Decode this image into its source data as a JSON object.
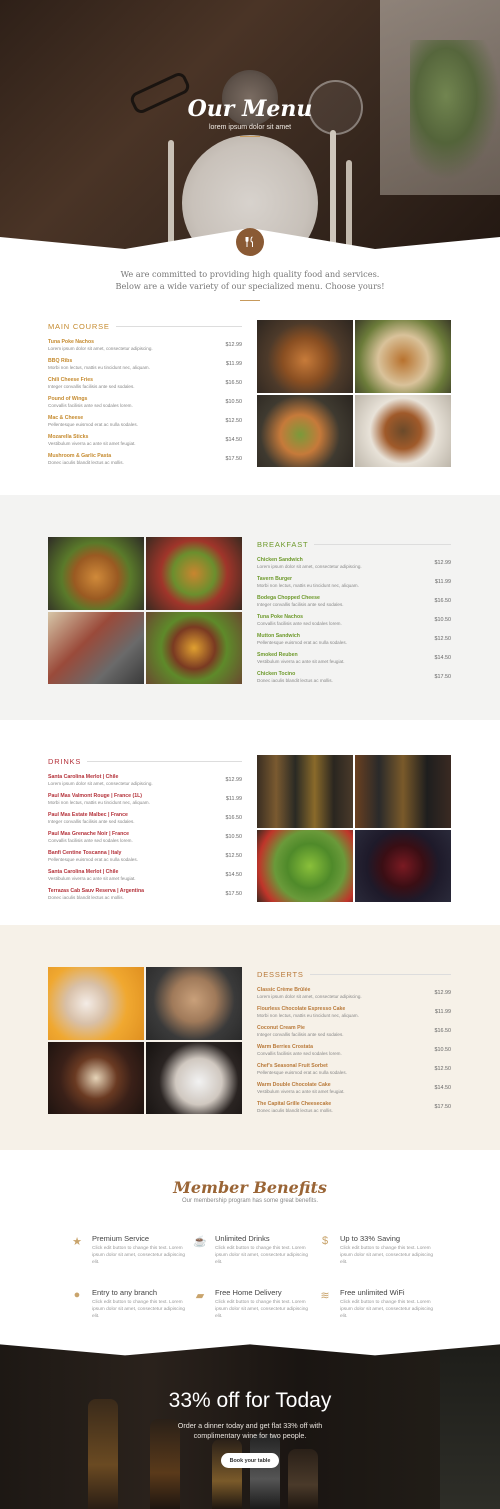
{
  "hero": {
    "title": "Our Menu",
    "subtitle": "lorem ipsum dolor sit amet"
  },
  "intro": "We are committed to providing high quality food and services. Below are a wide variety of our specialized menu. Choose yours!",
  "main_course": {
    "title": "MAIN COURSE",
    "items": [
      {
        "name": "Tuna Poke Nachos",
        "desc": "Lorem ipsum dolor sit amet, consectetur adipiscing.",
        "price": "$12.99"
      },
      {
        "name": "BBQ Ribs",
        "desc": "Morbi non lectus, mattis eu tincidunt nec, aliquam.",
        "price": "$11.99"
      },
      {
        "name": "Chili Cheese Fries",
        "desc": "Integer convallis facilisis ante sed sodales.",
        "price": "$16.50"
      },
      {
        "name": "Pound of Wings",
        "desc": "Convallis facilisis ante sed sodales lorem.",
        "price": "$10.50"
      },
      {
        "name": "Mac & Cheese",
        "desc": "Pellentesque euismod erat ac nulla sodales.",
        "price": "$12.50"
      },
      {
        "name": "Mozarella Sticks",
        "desc": "Vestibulum viverra ac ante sit amet feugiat.",
        "price": "$14.50"
      },
      {
        "name": "Mushroom & Garlic Pasta",
        "desc": "Donec iaculis blandit lectus ac mollis.",
        "price": "$17.50"
      }
    ]
  },
  "breakfast": {
    "title": "BREAKFAST",
    "items": [
      {
        "name": "Chicken Sandwich",
        "desc": "Lorem ipsum dolor sit amet, consectetur adipiscing.",
        "price": "$12.99"
      },
      {
        "name": "Tavern Burger",
        "desc": "Morbi non lectus, mattis eu tincidunt nec, aliquam.",
        "price": "$11.99"
      },
      {
        "name": "Bodega Chopped Cheese",
        "desc": "Integer convallis facilisis ante sed sodales.",
        "price": "$16.50"
      },
      {
        "name": "Tuna Poke Nachos",
        "desc": "Convallis facilisis ante sed sodales lorem.",
        "price": "$10.50"
      },
      {
        "name": "Mutton Sandwich",
        "desc": "Pellentesque euismod erat ac nulla sodales.",
        "price": "$12.50"
      },
      {
        "name": "Smoked Reuben",
        "desc": "Vestibulum viverra ac ante sit amet feugiat.",
        "price": "$14.50"
      },
      {
        "name": "Chicken Tocino",
        "desc": "Donec iaculis blandit lectus ac mollis.",
        "price": "$17.50"
      }
    ]
  },
  "drinks": {
    "title": "DRINKS",
    "items": [
      {
        "name": "Santa Carolina Merlot | Chile",
        "desc": "Lorem ipsum dolor sit amet, consectetur adipiscing.",
        "price": "$12.99"
      },
      {
        "name": "Paul Mas Valmont Rouge | France (1L)",
        "desc": "Morbi non lectus, mattis eu tincidunt nec, aliquam.",
        "price": "$11.99"
      },
      {
        "name": "Paul Mas Estate Malbec | France",
        "desc": "Integer convallis facilisis ante sed sodales.",
        "price": "$16.50"
      },
      {
        "name": "Paul Mas Grenache Noir | France",
        "desc": "Convallis facilisis ante sed sodales lorem.",
        "price": "$10.50"
      },
      {
        "name": "Banfi Centine Toscanna | Italy",
        "desc": "Pellentesque euismod erat ac nulla sodales.",
        "price": "$12.50"
      },
      {
        "name": "Santa Carolina Merlot | Chile",
        "desc": "Vestibulum viverra ac ante sit amet feugiat.",
        "price": "$14.50"
      },
      {
        "name": "Terrazas Cab Sauv Reserva | Argentina",
        "desc": "Donec iaculis blandit lectus ac mollis.",
        "price": "$17.50"
      }
    ]
  },
  "desserts": {
    "title": "DESSERTS",
    "items": [
      {
        "name": "Classic Crème Brûlée",
        "desc": "Lorem ipsum dolor sit amet, consectetur adipiscing.",
        "price": "$12.99"
      },
      {
        "name": "Flourless Chocolate Espresso Cake",
        "desc": "Morbi non lectus, mattis eu tincidunt nec, aliquam.",
        "price": "$11.99"
      },
      {
        "name": "Coconut Cream Pie",
        "desc": "Integer convallis facilisis ante sed sodales.",
        "price": "$16.50"
      },
      {
        "name": "Warm Berries Crostata",
        "desc": "Convallis facilisis ante sed sodales lorem.",
        "price": "$10.50"
      },
      {
        "name": "Chef's Seasonal Fruit Sorbet",
        "desc": "Pellentesque euismod erat ac nulla sodales.",
        "price": "$12.50"
      },
      {
        "name": "Warm Double Chocolate Cake",
        "desc": "Vestibulum viverra ac ante sit amet feugiat.",
        "price": "$14.50"
      },
      {
        "name": "The Capital Grille Cheesecake",
        "desc": "Donec iaculis blandit lectus ac mollis.",
        "price": "$17.50"
      }
    ]
  },
  "member": {
    "title": "Member Benefits",
    "subtitle": "Our membership program has some great benefits.",
    "benefits": [
      {
        "title": "Premium Service",
        "desc": "Click edit button to change this text. Lorem ipsum dolor sit amet, consectetur adipiscing elit.",
        "icon": "star-icon"
      },
      {
        "title": "Unlimited Drinks",
        "desc": "Click edit button to change this text. Lorem ipsum dolor sit amet, consectetur adipiscing elit.",
        "icon": "cup-icon"
      },
      {
        "title": "Up to 33% Saving",
        "desc": "Click edit button to change this text. Lorem ipsum dolor sit amet, consectetur adipiscing elit.",
        "icon": "money-icon"
      },
      {
        "title": "Entry to any branch",
        "desc": "Click edit button to change this text. Lorem ipsum dolor sit amet, consectetur adipiscing elit.",
        "icon": "globe-icon"
      },
      {
        "title": "Free Home Delivery",
        "desc": "Click edit button to change this text. Lorem ipsum dolor sit amet, consectetur adipiscing elit.",
        "icon": "truck-icon"
      },
      {
        "title": "Free unlimited WiFi",
        "desc": "Click edit button to change this text. Lorem ipsum dolor sit amet, consectetur adipiscing elit.",
        "icon": "wifi-icon"
      }
    ]
  },
  "promo": {
    "title": "33% off for Today",
    "text": "Order a dinner today and get flat 33% off with complimentary wine for two people.",
    "button": "Book your table"
  },
  "colors": {
    "accent": "#8a5a34",
    "gold": "#c58a2e",
    "green": "#6e9a2c",
    "red": "#b4323a"
  }
}
